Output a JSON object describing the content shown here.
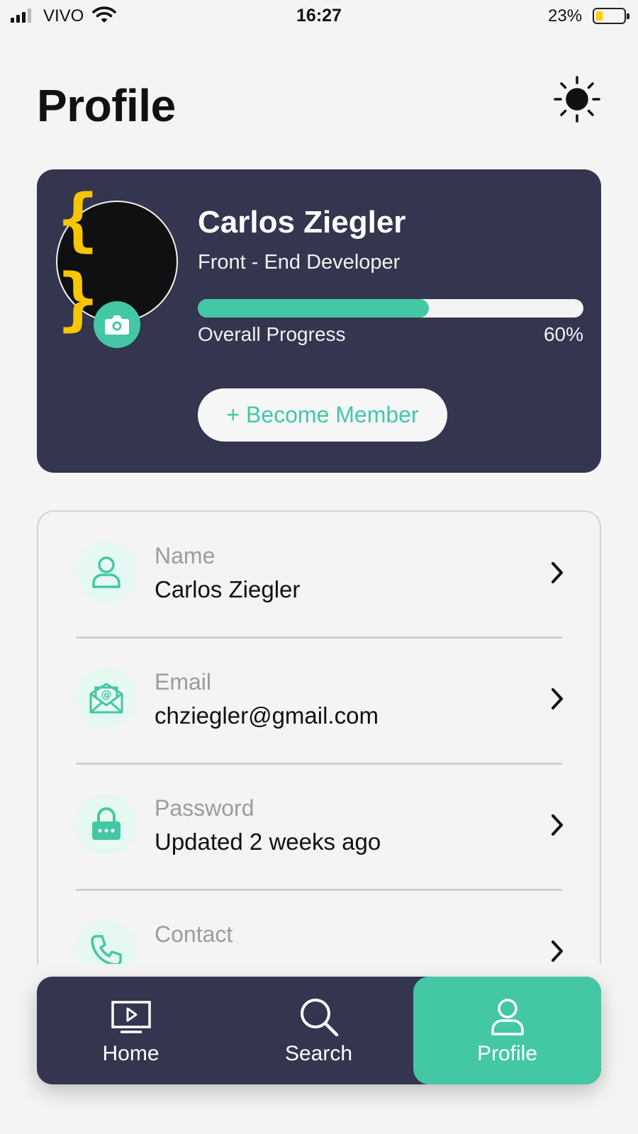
{
  "status_bar": {
    "carrier": "VIVO",
    "time": "16:27",
    "battery_percent": "23%",
    "battery_level": 0.23,
    "signal_bars": 3,
    "signal_bars_total": 4
  },
  "header": {
    "title": "Profile",
    "theme_icon": "theme-toggle-icon"
  },
  "profile_card": {
    "name": "Carlos Ziegler",
    "role": "Front - End Developer",
    "avatar_glyph": "{ }",
    "progress_label": "Overall Progress",
    "progress_value": "60%",
    "progress_fraction": 0.6,
    "member_button": "+ Become Member"
  },
  "settings": [
    {
      "label": "Name",
      "value": "Carlos Ziegler",
      "icon": "user-icon"
    },
    {
      "label": "Email",
      "value": "chziegler@gmail.com",
      "icon": "email-icon"
    },
    {
      "label": "Password",
      "value": "Updated 2 weeks ago",
      "icon": "lock-icon"
    },
    {
      "label": "Contact",
      "value": "",
      "icon": "phone-icon"
    }
  ],
  "bottom_nav": [
    {
      "label": "Home",
      "icon": "tv-play-icon",
      "active": false
    },
    {
      "label": "Search",
      "icon": "search-icon",
      "active": false
    },
    {
      "label": "Profile",
      "icon": "user-icon",
      "active": true
    }
  ],
  "colors": {
    "accent": "#44c7a5",
    "card_background": "#34354f",
    "page_background": "#f4f4f4",
    "avatar_glyph": "#f7c600",
    "battery_fill": "#ffcc00"
  }
}
